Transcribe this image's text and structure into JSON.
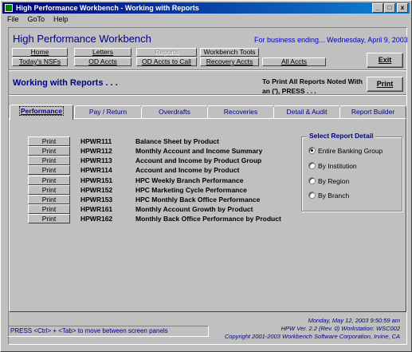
{
  "window": {
    "title": "High Performance Workbench - Working with Reports",
    "minimize": "_",
    "maximize": "□",
    "close": "x"
  },
  "menu": [
    "File",
    "GoTo",
    "Help"
  ],
  "app": {
    "title": "High Performance Workbench",
    "business_date": "For business ending... Wednesday, April 9, 2003"
  },
  "nav": {
    "row1": [
      "Home",
      "Letters",
      "Reports",
      "Workbench Tools"
    ],
    "row2": [
      "Today's NSFs",
      "OD Accts",
      "OD Accts to Call",
      "Recovery Accts",
      "All Accts"
    ],
    "exit": "Exit"
  },
  "section": {
    "title": "Working with Reports . . .",
    "print_note": "To Print All Reports Noted With an ('), PRESS . . .",
    "print_button": "Print"
  },
  "tabs": [
    "Performance",
    "Pay / Return",
    "Overdrafts",
    "Recoveries",
    "Detail & Audit",
    "Report Builder"
  ],
  "reports": [
    {
      "print": "Print",
      "code": "HPWR111",
      "desc": "Balance Sheet by Product"
    },
    {
      "print": "Print",
      "code": "HPWR112",
      "desc": "Monthly Account and Income Summary"
    },
    {
      "print": "Print",
      "code": "HPWR113",
      "desc": "Account and Income by Product Group"
    },
    {
      "print": "Print",
      "code": "HPWR114",
      "desc": "Account and Income by Product"
    },
    {
      "print": "Print",
      "code": "HPWR151",
      "desc": "HPC Weekly Branch Performance"
    },
    {
      "print": "Print",
      "code": "HPWR152",
      "desc": "HPC Marketing Cycle Performance"
    },
    {
      "print": "Print",
      "code": "HPWR153",
      "desc": "HPC Monthly Back Office Performance"
    },
    {
      "print": "Print",
      "code": "HPWR161",
      "desc": "Monthly Account Growth by Product"
    },
    {
      "print": "Print",
      "code": "HPWR162",
      "desc": "Monthly Back Office Performance by Product"
    }
  ],
  "report_detail": {
    "title": "Select Report Detail",
    "options": [
      "Entire Banking Group",
      "By Institution",
      "By Region",
      "By Branch"
    ],
    "selected": 0
  },
  "status": {
    "hint": "PRESS <Ctrl> + <Tab> to move between screen panels",
    "datetime": "Monday, May 12, 2003   9:50:59 am",
    "version": "HPW  Ver. 2.2  (Rev. 0)        Workstation:  WSC002",
    "copyright": "Copyright 2001-2003   Workbench Software Corporation, Irvine, CA"
  }
}
